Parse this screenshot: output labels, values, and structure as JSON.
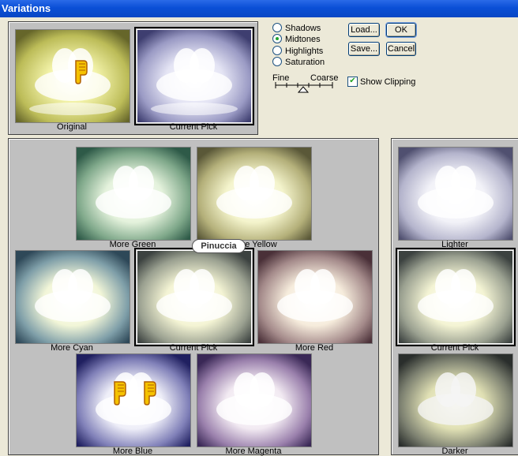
{
  "window": {
    "title": "Variations"
  },
  "top": {
    "original_label": "Original",
    "current_pick_label": "Current Pick"
  },
  "options": {
    "radios": [
      {
        "label": "Shadows",
        "checked": false
      },
      {
        "label": "Midtones",
        "checked": true
      },
      {
        "label": "Highlights",
        "checked": false
      },
      {
        "label": "Saturation",
        "checked": false
      }
    ],
    "fine_label": "Fine",
    "coarse_label": "Coarse",
    "show_clipping_label": "Show Clipping",
    "show_clipping_checked": true
  },
  "buttons": {
    "load": "Load...",
    "ok": "OK",
    "save": "Save...",
    "cancel": "Cancel"
  },
  "grid": {
    "more_green": "More Green",
    "more_yellow": "More Yellow",
    "more_cyan": "More Cyan",
    "current_pick": "Current Pick",
    "more_red": "More Red",
    "more_blue": "More Blue",
    "more_magenta": "More Magenta"
  },
  "brightness": {
    "lighter": "Lighter",
    "current_pick": "Current Pick",
    "darker": "Darker"
  },
  "watermark": {
    "text": "Pinuccia"
  },
  "colors": {
    "title_bar": "#0a4fd6",
    "dialog_bg": "#ece9d8",
    "panel_bg": "#c0c0c0"
  }
}
